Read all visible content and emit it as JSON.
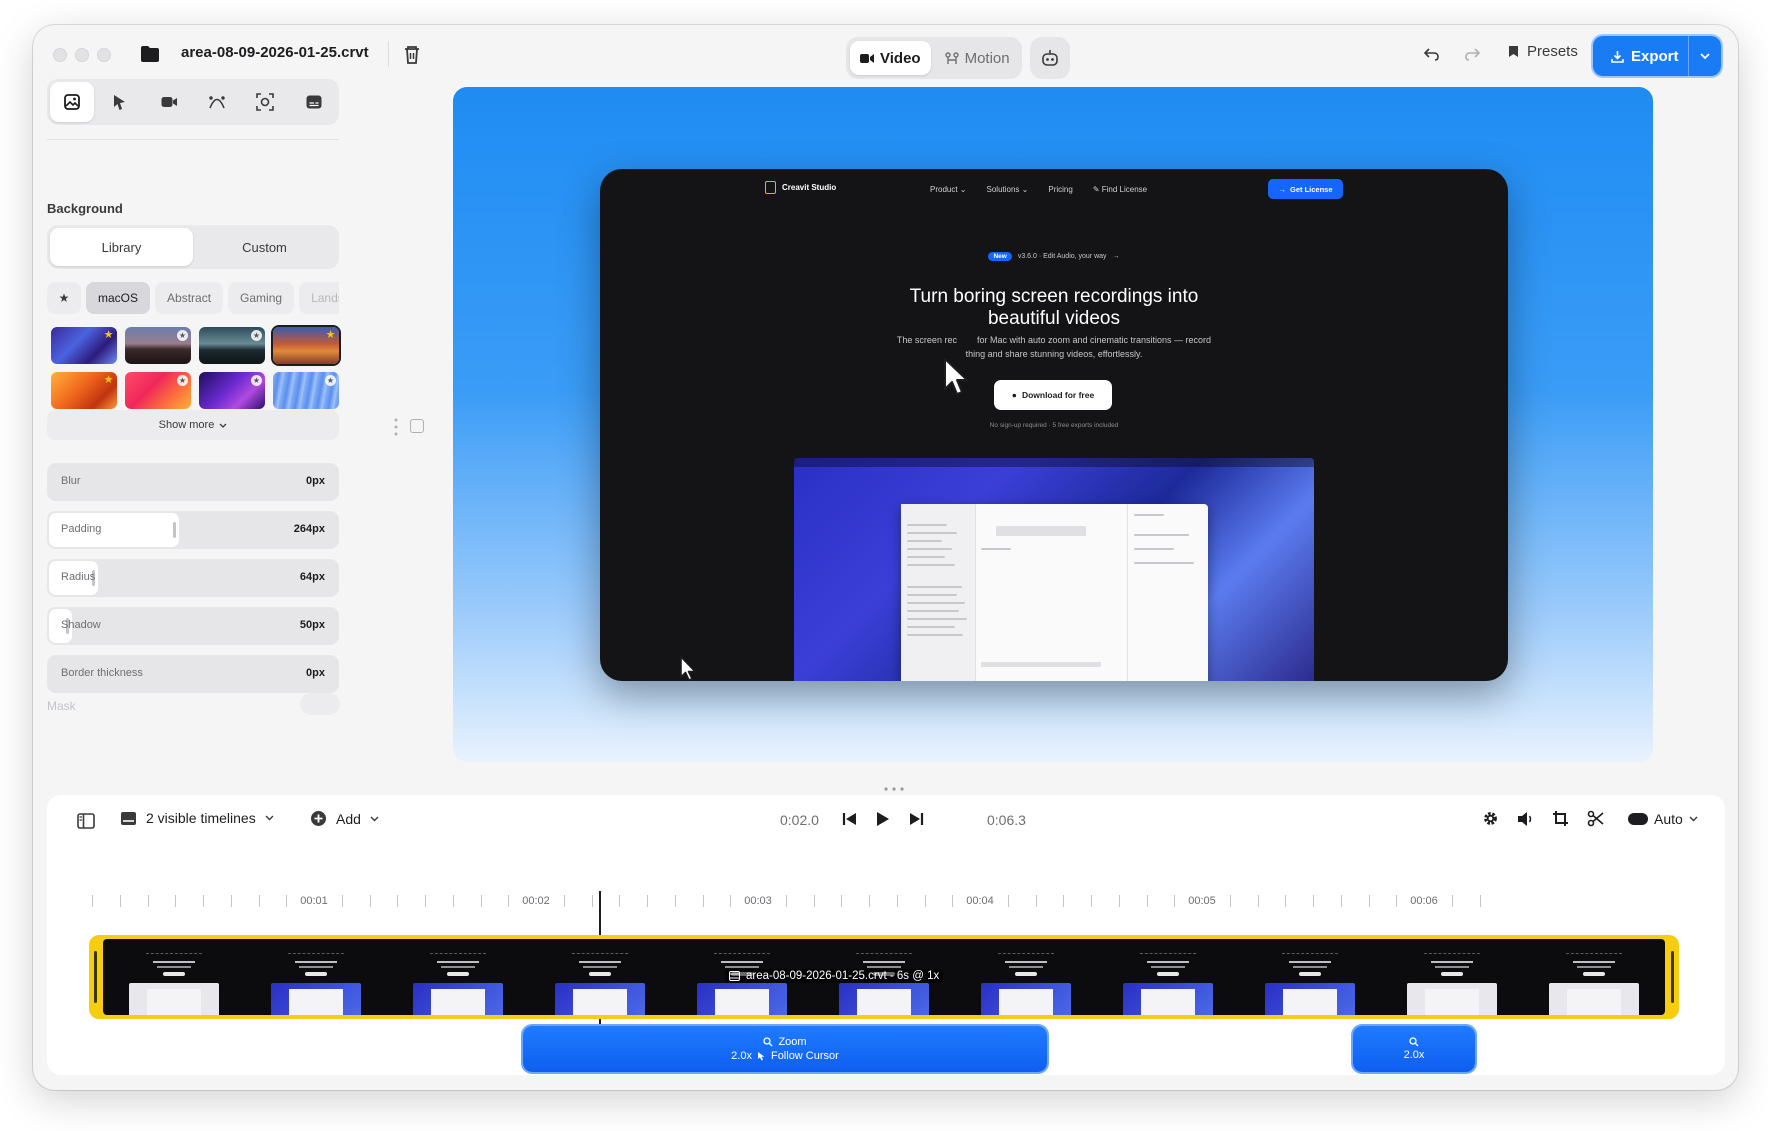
{
  "window": {
    "filename": "area-08-09-2026-01-25.crvt",
    "modes": [
      {
        "label": "Video",
        "active": true
      },
      {
        "label": "Motion",
        "active": false
      }
    ],
    "presets_label": "Presets",
    "export_label": "Export"
  },
  "sidebar": {
    "tools": [
      "background-icon",
      "cursor-icon",
      "camera-icon",
      "curve-icon",
      "focus-icon",
      "captions-icon"
    ],
    "section_title": "Background",
    "segments": [
      {
        "label": "Library",
        "active": true
      },
      {
        "label": "Custom",
        "active": false
      }
    ],
    "categories": [
      {
        "label": "macOS",
        "active": true
      },
      {
        "label": "Abstract",
        "active": false
      },
      {
        "label": "Gaming",
        "active": false
      },
      {
        "label": "Landsca",
        "active": false
      }
    ],
    "show_more_label": "Show more",
    "sliders": [
      {
        "label": "Blur",
        "value": "0px",
        "fraction": 0.0
      },
      {
        "label": "Padding",
        "value": "264px",
        "fraction": 0.45
      },
      {
        "label": "Radius",
        "value": "64px",
        "fraction": 0.17
      },
      {
        "label": "Shadow",
        "value": "50px",
        "fraction": 0.08
      },
      {
        "label": "Border thickness",
        "value": "0px",
        "fraction": 0.0
      }
    ],
    "mask_label": "Mask"
  },
  "preview": {
    "site": {
      "brand": "Creavit Studio",
      "nav": [
        "Product",
        "Solutions",
        "Pricing",
        "Find License"
      ],
      "cta": "Get License",
      "announce_pill": "New",
      "announce_text": "v3.6.0 · Edit Audio, your way",
      "headline_1": "Turn boring screen recordings into",
      "headline_2": "beautiful videos",
      "sub_1": "The screen rec        for Mac with auto zoom and cinematic transitions — record",
      "sub_2": "thing and share stunning videos, effortlessly.",
      "download": "Download for free",
      "note": "No sign-up required · 5 free exports included"
    }
  },
  "timeline": {
    "visible_label": "2 visible timelines",
    "add_label": "Add",
    "current_time": "0:02.0",
    "total_time": "0:06.3",
    "auto_label": "Auto",
    "ruler_labels": [
      "00:01",
      "00:02",
      "00:03",
      "00:04",
      "00:05",
      "00:06"
    ],
    "clip_label": "area-08-09-2026-01-25.crvt - 6s @ 1x",
    "zoom_1": {
      "title": "Zoom",
      "detail_scale": "2.0x",
      "detail_mode": "Follow Cursor"
    },
    "zoom_2": {
      "detail_scale": "2.0x"
    }
  }
}
